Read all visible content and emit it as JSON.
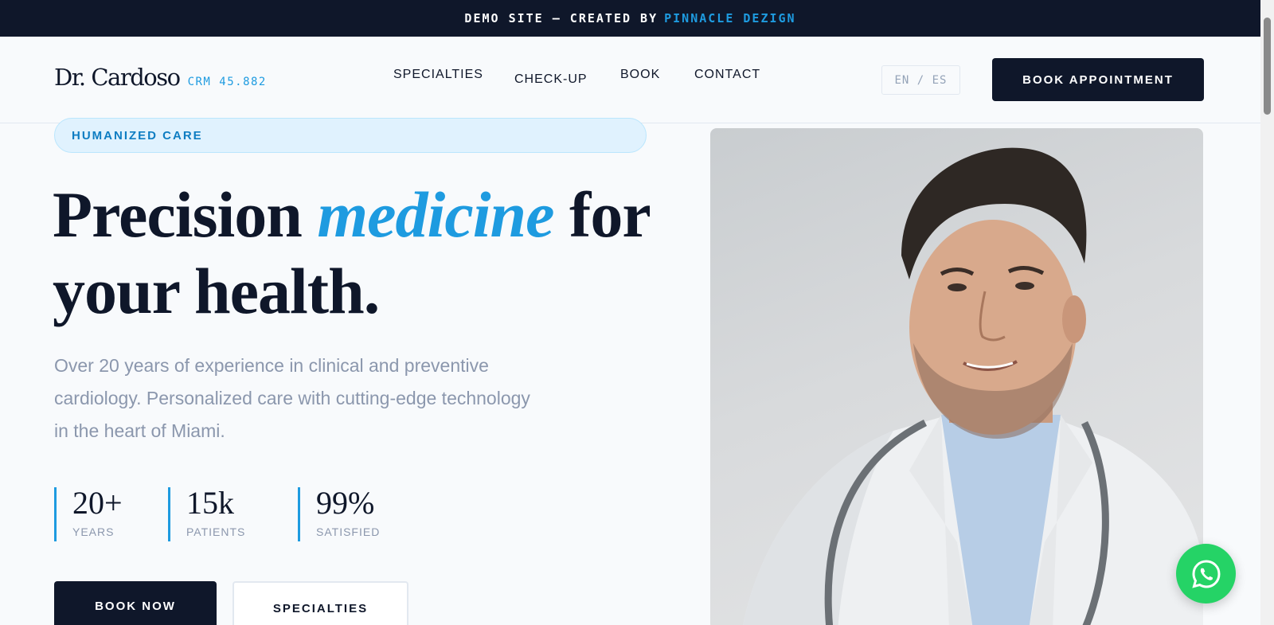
{
  "banner": {
    "prefix": "DEMO SITE — CREATED BY",
    "accent": "PINNACLE DEZIGN"
  },
  "header": {
    "logo_name": "Dr. Cardoso",
    "logo_crm": "CRM 45.882",
    "nav": [
      "SPECIALTIES",
      "CHECK-UP",
      "BOOK",
      "CONTACT"
    ],
    "lang_toggle": "EN / ES",
    "cta": "BOOK APPOINTMENT"
  },
  "hero": {
    "badge": "HUMANIZED CARE",
    "headline_part1": "Precision",
    "headline_em": "medicine",
    "headline_part2": "for your health.",
    "subtitle": "Over 20 years of experience in clinical and preventive cardiology. Personalized care with cutting-edge technology in the heart of Miami.",
    "stats": [
      {
        "value": "20+",
        "label": "YEARS"
      },
      {
        "value": "15k",
        "label": "PATIENTS"
      },
      {
        "value": "99%",
        "label": "SATISFIED"
      }
    ],
    "primary_button": "BOOK NOW",
    "secondary_button": "SPECIALTIES"
  },
  "colors": {
    "navy": "#0f172a",
    "accent": "#1e9be0",
    "muted": "#8b97ad",
    "whatsapp": "#25d366"
  },
  "icons": {
    "floating_button": "whatsapp-icon"
  }
}
